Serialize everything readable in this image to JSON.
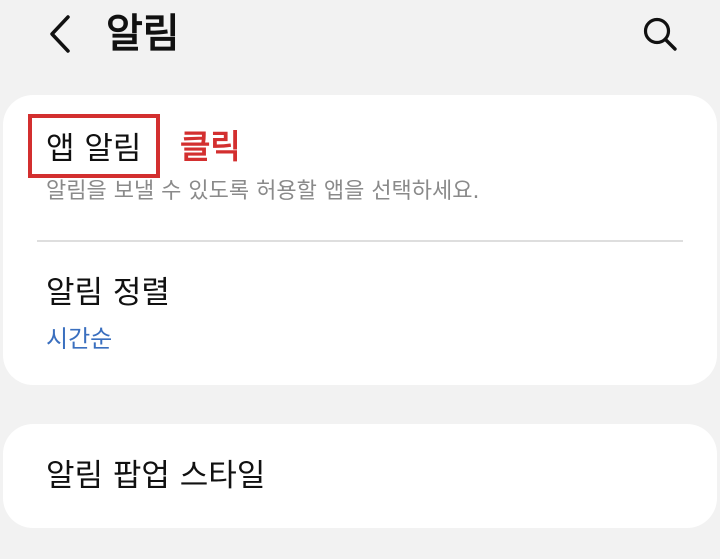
{
  "header": {
    "title": "알림",
    "back_icon": "chevron-left-icon",
    "search_icon": "search-icon"
  },
  "sections": {
    "main": {
      "app_notifications": {
        "title": "앱 알림",
        "description": "알림을 보낼 수 있도록 허용할 앱을 선택하세요."
      },
      "sort": {
        "title": "알림 정렬",
        "value": "시간순"
      }
    },
    "popup": {
      "title": "알림 팝업 스타일"
    }
  },
  "annotation": {
    "click_label": "클릭",
    "color": "#d32f2f"
  },
  "colors": {
    "background": "#f2f2f2",
    "card": "#ffffff",
    "accent_value": "#3a6fbf"
  }
}
